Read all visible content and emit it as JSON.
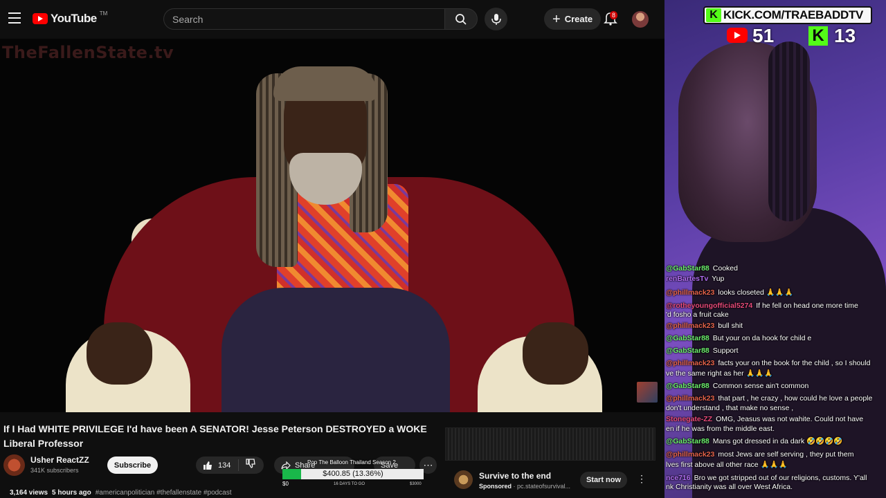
{
  "youtube": {
    "logo_text": "YouTube",
    "logo_tm": "TM",
    "search_placeholder": "Search",
    "create_label": "Create",
    "notifications_count": "8",
    "video": {
      "watermark": "TheFallenState.tv",
      "title": "If I Had WHITE PRIVILEGE I'd have been A SENATOR! Jesse Peterson DESTROYED a WOKE Liberal Professor",
      "channel_name": "Usher ReactZZ",
      "subscribers": "341K subscribers",
      "subscribe_label": "Subscribe",
      "likes": "134",
      "share_label": "Share",
      "save_label": "Save",
      "views": "3,164 views",
      "age": "5 hours ago",
      "tags": "#americanpolitician #thefallenstate #podcast"
    },
    "ad": {
      "title": "Survive to the end",
      "sponsored_label": "Sponsored",
      "sponsor_domain": "pc.stateofsurvival...",
      "cta_label": "Start now"
    }
  },
  "goal": {
    "title": "Pop The Balloon Thailand Season 2",
    "amount_text": "$400.85 (13.36%)",
    "progress_percent": 13.36,
    "min_label": "$0",
    "days_label": "16 DAYS TO GO",
    "max_label": "$3000"
  },
  "stream": {
    "kick_url": "KICK.COM/TRAEBADDTV",
    "youtube_viewers": "51",
    "kick_viewers": "13"
  },
  "chat": [
    {
      "user": "@GabStar88",
      "text": "Cooked",
      "color": "green"
    },
    {
      "user": "renBartesTv",
      "text": "Yup",
      "color": "purple"
    },
    {
      "user": "@phillmack23",
      "text": "looks closeted 🙏🙏🙏",
      "color": "orange"
    },
    {
      "user": "@rotheyoungofficial5274",
      "text": "If he fell on head one more time",
      "color": "pink"
    },
    {
      "user": "",
      "text": "'d fosho a fruit cake",
      "color": "gray"
    },
    {
      "user": "@phillmack23",
      "text": "bull shit",
      "color": "orange"
    },
    {
      "user": "@GabStar88",
      "text": "But your on da hook for child e",
      "color": "green"
    },
    {
      "user": "@GabStar88",
      "text": "Support",
      "color": "green"
    },
    {
      "user": "@phillmack23",
      "text": "facts your on the book for the child , so I should",
      "color": "orange"
    },
    {
      "user": "",
      "text": "ve the same right as her 🙏🙏🙏",
      "color": "gray"
    },
    {
      "user": "@GabStar88",
      "text": "Common sense ain't common",
      "color": "green"
    },
    {
      "user": "@phillmack23",
      "text": "that part , he crazy , how could he love a people",
      "color": "orange"
    },
    {
      "user": "",
      "text": "don't understand , that make no sense ,",
      "color": "gray"
    },
    {
      "user": "Stonegate-ZZ",
      "text": "OMG, Jeasus was not wahite. Could not have",
      "color": "pink"
    },
    {
      "user": "",
      "text": "en if he was from the middle east.",
      "color": "gray"
    },
    {
      "user": "@GabStar88",
      "text": "Mans got dressed in da dark 🤣🤣🤣🤣",
      "color": "green"
    },
    {
      "user": "@phillmack23",
      "text": "most Jews are self serving , they put them",
      "color": "orange"
    },
    {
      "user": "",
      "text": "lves first above all other race 🙏🙏🙏",
      "color": "gray"
    },
    {
      "user": "nce716",
      "text": "Bro we got stripped out of our religions, customs. Y'all",
      "color": "purple"
    },
    {
      "user": "",
      "text": "nk Christianity was all over West Africa.",
      "color": "gray"
    }
  ]
}
